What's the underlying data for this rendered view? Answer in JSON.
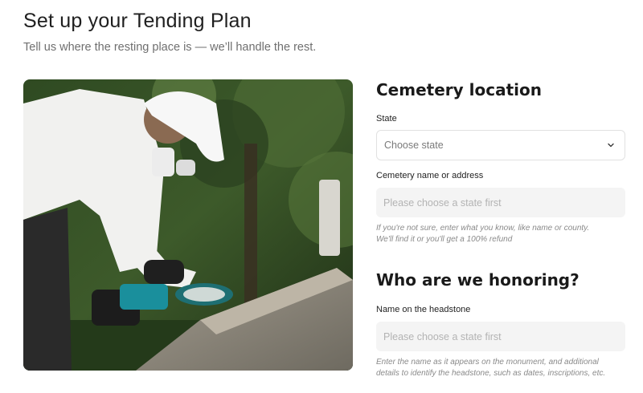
{
  "header": {
    "title": "Set up your Tending Plan",
    "subtitle": "Tell us where the resting place is — we’ll handle the rest."
  },
  "photo": {
    "icon": "photo-worker-grinding-headstone"
  },
  "location_section": {
    "heading": "Cemetery location",
    "state_label": "State",
    "state_value": "Choose state",
    "cemetery_label": "Cemetery name or address",
    "cemetery_placeholder": "Please choose a state first",
    "cemetery_help_line1": "If you're not sure, enter what you know, like name or county.",
    "cemetery_help_line2": "We'll find it or you'll get a 100% refund"
  },
  "honoring_section": {
    "heading": "Who are we honoring?",
    "name_label": "Name on the headstone",
    "name_placeholder": "Please choose a state first",
    "name_help": "Enter the name as it appears on the monument, and additional details to identify the headstone, such as dates, inscriptions, etc."
  },
  "colors": {
    "input_background": "#f4f4f4",
    "border": "#e1e1e1",
    "heading": "#1a1a1a",
    "muted_text": "#6f6f6f"
  }
}
